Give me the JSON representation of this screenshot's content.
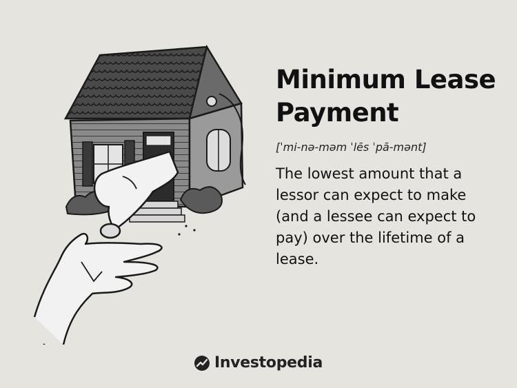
{
  "term": {
    "title": "Minimum Lease Payment",
    "pronunciation": "[ˈmi-nə-məm ˈlēs ˈpā-mənt]",
    "definition": "The lowest amount that a lessor can expect to make (and a lessee can expect to pay) over the lifetime of a lease."
  },
  "brand": {
    "name": "Investopedia",
    "logo_icon": "investopedia-logo-icon"
  },
  "illustration": {
    "subject": "house-with-hands-icon"
  },
  "colors": {
    "background": "#e6e4df",
    "text": "#111111",
    "ink": "#2b2b2b"
  }
}
